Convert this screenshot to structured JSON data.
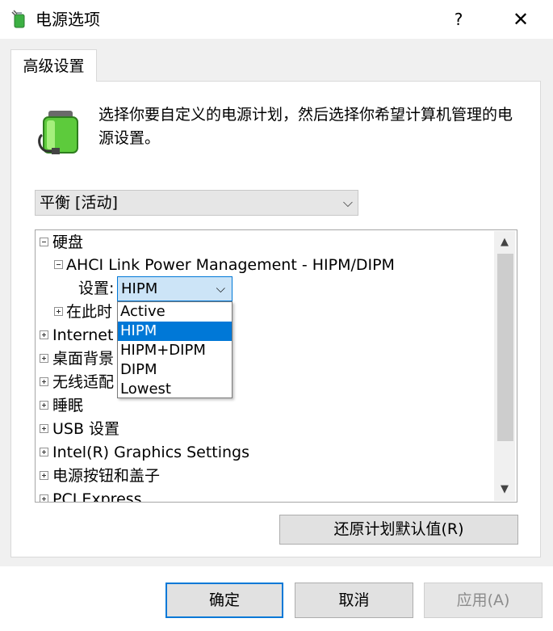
{
  "window": {
    "title": "电源选项",
    "help_label": "?",
    "close_label": "✕"
  },
  "tab": {
    "label": "高级设置"
  },
  "description": "选择你要自定义的电源计划，然后选择你希望计算机管理的电源设置。",
  "plan_select": {
    "value": "平衡 [活动]"
  },
  "tree": {
    "hard_disk": "硬盘",
    "ahci": "AHCI Link Power Management - HIPM/DIPM",
    "setting_label": "设置:",
    "setting_value": "HIPM",
    "turn_off_after": "在此时",
    "internet": "Internet",
    "desktop_bg": "桌面背景",
    "wireless": "无线适配",
    "sleep": "睡眠",
    "usb": "USB 设置",
    "intel_graphics": "Intel(R) Graphics Settings",
    "power_buttons": "电源按钮和盖子",
    "pci_express": "PCI Express"
  },
  "dropdown": {
    "options": [
      "Active",
      "HIPM",
      "HIPM+DIPM",
      "DIPM",
      "Lowest"
    ],
    "selected": "HIPM"
  },
  "buttons": {
    "restore": "还原计划默认值(R)",
    "ok": "确定",
    "cancel": "取消",
    "apply": "应用(A)"
  },
  "colors": {
    "accent": "#0078d7",
    "selection_bg": "#cce4f7"
  }
}
